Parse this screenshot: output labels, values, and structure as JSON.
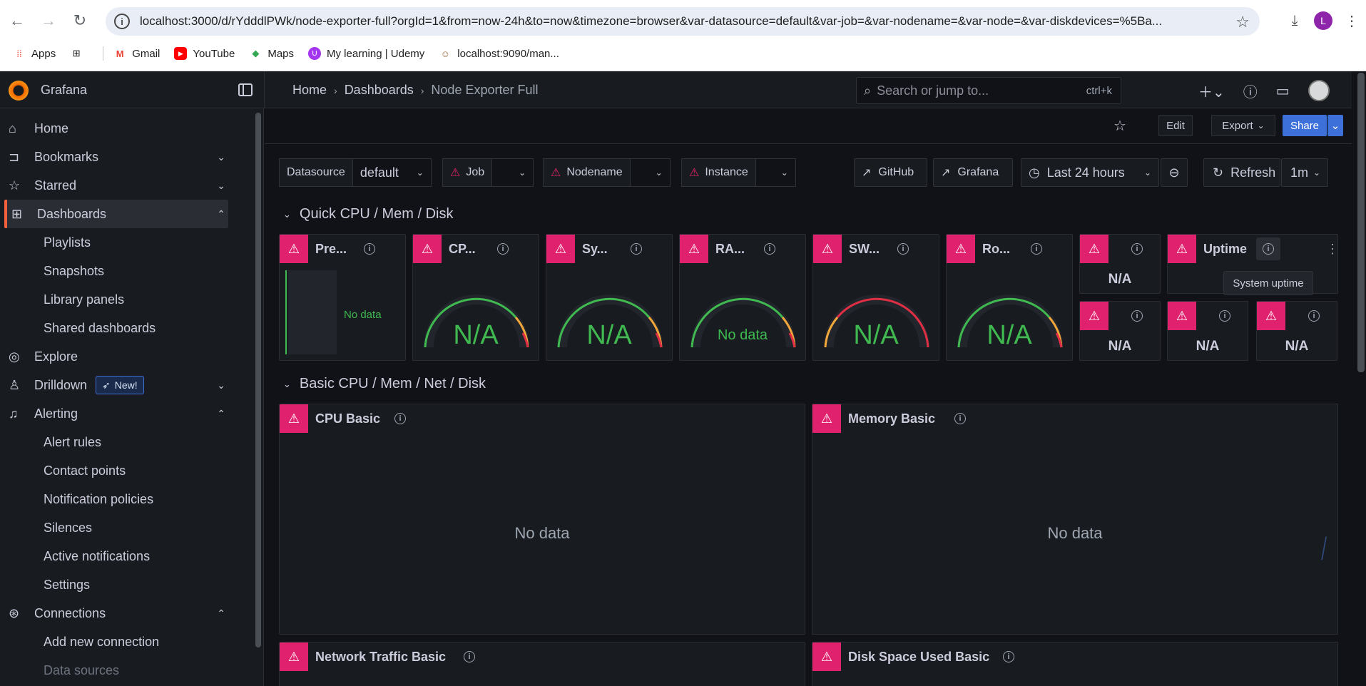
{
  "browser": {
    "url": "localhost:3000/d/rYdddlPWk/node-exporter-full?orgId=1&from=now-24h&to=now&timezone=browser&var-datasource=default&var-job=&var-nodename=&var-node=&var-diskdevices=%5Ba...",
    "profile_initial": "L",
    "bookmarks": [
      "Apps",
      "Gmail",
      "YouTube",
      "Maps",
      "My learning | Udemy",
      "localhost:9090/man..."
    ]
  },
  "grafana": {
    "app_name": "Grafana",
    "breadcrumbs": [
      "Home",
      "Dashboards",
      "Node Exporter Full"
    ],
    "search_placeholder": "Search or jump to...",
    "search_shortcut": "ctrl+k"
  },
  "sidebar": {
    "items": [
      {
        "label": "Home",
        "icon": "home-icon"
      },
      {
        "label": "Bookmarks",
        "icon": "bookmark-icon"
      },
      {
        "label": "Starred",
        "icon": "star-icon"
      },
      {
        "label": "Dashboards",
        "icon": "dashboards-icon"
      },
      {
        "label": "Playlists"
      },
      {
        "label": "Snapshots"
      },
      {
        "label": "Library panels"
      },
      {
        "label": "Shared dashboards"
      },
      {
        "label": "Explore",
        "icon": "compass-icon"
      },
      {
        "label": "Drilldown",
        "icon": "drilldown-icon",
        "badge": "New!"
      },
      {
        "label": "Alerting",
        "icon": "bell-icon"
      },
      {
        "label": "Alert rules"
      },
      {
        "label": "Contact points"
      },
      {
        "label": "Notification policies"
      },
      {
        "label": "Silences"
      },
      {
        "label": "Active notifications"
      },
      {
        "label": "Settings"
      },
      {
        "label": "Connections",
        "icon": "connections-icon"
      },
      {
        "label": "Add new connection"
      },
      {
        "label": "Data sources"
      }
    ]
  },
  "actions": {
    "edit": "Edit",
    "export": "Export",
    "share": "Share"
  },
  "variables": {
    "datasource_label": "Datasource",
    "datasource_value": "default",
    "job_label": "Job",
    "nodename_label": "Nodename",
    "instance_label": "Instance"
  },
  "links": {
    "github": "GitHub",
    "grafana": "Grafana"
  },
  "time": {
    "range": "Last 24 hours",
    "refresh": "Refresh",
    "interval": "1m"
  },
  "rows": {
    "row1": "Quick CPU / Mem / Disk",
    "row2": "Basic CPU / Mem / Net / Disk"
  },
  "panels": {
    "pressure": "Pre...",
    "cpu": "CP...",
    "sysload": "Sy...",
    "ram": "RA...",
    "swap": "SW...",
    "rootfs": "Ro...",
    "uptime": "Uptime",
    "cpu_basic": "CPU Basic",
    "memory_basic": "Memory Basic",
    "network_basic": "Network Traffic Basic",
    "disk_basic": "Disk Space Used Basic"
  },
  "values": {
    "na": "N/A",
    "no_data": "No data"
  },
  "tooltip": "System uptime",
  "colors": {
    "accent": "#f55f3e",
    "error": "#e0226e",
    "ok": "#3fb950",
    "primary": "#3d71d9"
  }
}
